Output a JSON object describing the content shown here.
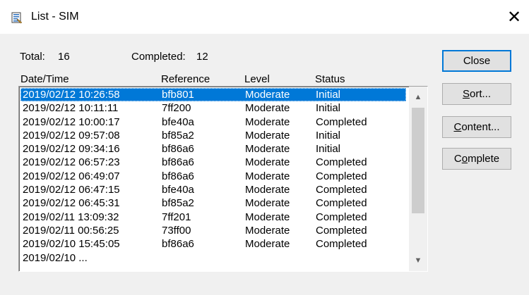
{
  "window": {
    "title": "List - SIM",
    "close_glyph": "✕",
    "icon": "list-document-icon"
  },
  "summary": {
    "total_label": "Total:",
    "total_value": "16",
    "completed_label": "Completed:",
    "completed_value": "12"
  },
  "columns": {
    "date_time": "Date/Time",
    "reference": "Reference",
    "level": "Level",
    "status": "Status"
  },
  "rows": [
    {
      "date_time": "2019/02/12 10:26:58",
      "reference": "bfb801",
      "level": "Moderate",
      "status": "Initial",
      "selected": true
    },
    {
      "date_time": "2019/02/12 10:11:11",
      "reference": "7ff200",
      "level": "Moderate",
      "status": "Initial"
    },
    {
      "date_time": "2019/02/12 10:00:17",
      "reference": "bfe40a",
      "level": "Moderate",
      "status": "Completed"
    },
    {
      "date_time": "2019/02/12 09:57:08",
      "reference": "bf85a2",
      "level": "Moderate",
      "status": "Initial"
    },
    {
      "date_time": "2019/02/12 09:34:16",
      "reference": "bf86a6",
      "level": "Moderate",
      "status": "Initial"
    },
    {
      "date_time": "2019/02/12 06:57:23",
      "reference": "bf86a6",
      "level": "Moderate",
      "status": "Completed"
    },
    {
      "date_time": "2019/02/12 06:49:07",
      "reference": "bf86a6",
      "level": "Moderate",
      "status": "Completed"
    },
    {
      "date_time": "2019/02/12 06:47:15",
      "reference": "bfe40a",
      "level": "Moderate",
      "status": "Completed"
    },
    {
      "date_time": "2019/02/12 06:45:31",
      "reference": "bf85a2",
      "level": "Moderate",
      "status": "Completed"
    },
    {
      "date_time": "2019/02/11 13:09:32",
      "reference": "7ff201",
      "level": "Moderate",
      "status": "Completed"
    },
    {
      "date_time": "2019/02/11 00:56:25",
      "reference": "73ff00",
      "level": "Moderate",
      "status": "Completed"
    },
    {
      "date_time": "2019/02/10 15:45:05",
      "reference": "bf86a6",
      "level": "Moderate",
      "status": "Completed"
    },
    {
      "date_time": "2019/02/10 ...",
      "reference": "",
      "level": "",
      "status": ""
    }
  ],
  "buttons": {
    "close": "Close",
    "sort_pre": "",
    "sort_u": "S",
    "sort_post": "ort...",
    "content_pre": "",
    "content_u": "C",
    "content_post": "ontent...",
    "complete_pre": "C",
    "complete_u": "o",
    "complete_post": "mplete"
  },
  "scrollbar": {
    "up_glyph": "▲",
    "down_glyph": "▼"
  },
  "colors": {
    "selection": "#0078d7",
    "background": "#f0f0f0",
    "button_face": "#e1e1e1"
  }
}
